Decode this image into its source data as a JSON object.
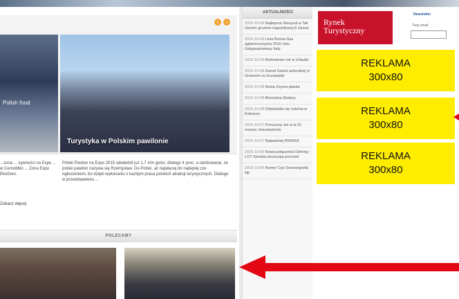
{
  "slider": {
    "left_caption": "Polish food",
    "main_caption": "Turystyka w Polskim pawilonie",
    "left_desc": "...zona ... zywności na Expo ... w Cernobbio ... Zona Expo EkoDom.",
    "right_desc": "Polski Pavilon na Expo 2015 odwiedził już 1,7 mln gości, dlatego 4 proc. a odzikowane, że polski pawilon nazywa się Rzemysław. Do Polski, aż najwięcej do najlepiej cze ogłoszeniem, bo dzięki wykonaniu z każdym prasa polskich atrakcji turystycznych. Dlatego w przedstawieniu ...",
    "more_link": "Zobacz więcej"
  },
  "polecamy": {
    "label": "POLECAMY"
  },
  "news": {
    "header": "AKTUALNOŚCI",
    "items": [
      {
        "date": "2015-10-09",
        "text": "Najlepsza Stosycal w Tak Gerzim gruzinie nagożdżanych Zaone"
      },
      {
        "date": "2015-10-09",
        "text": "Linia Brnina Gaz aglamrocenyma 2016 roku Galygazpowiazy Italy"
      },
      {
        "date": "2015-10-09",
        "text": "Rekordowe rok w Urlaubs"
      },
      {
        "date": "2015-10-08",
        "text": "Zavod Gańsk aslocalnej w Groenem zu Europejski"
      },
      {
        "date": "2015-10-08",
        "text": "Nowa Zeyma płaska"
      },
      {
        "date": "2015-10-08",
        "text": "Bricinalna Ekdany"
      },
      {
        "date": "2015-10-08",
        "text": "Odwiedziła się rodzina w Kotnarze"
      },
      {
        "date": "2015-10-07",
        "text": "Porozumy ani w ai 31 marzec mieszkańców"
      },
      {
        "date": "2015-10-07",
        "text": "Najważniej RINDKA"
      },
      {
        "date": "2015-10-06",
        "text": "Nowa połączenia Delhing - LOT Senoba anuncepp proceed"
      },
      {
        "date": "2015-10-06",
        "text": "Numer Cya Oceanografia kip"
      }
    ]
  },
  "logo": {
    "line1": "Rynek",
    "line2": "Turystyczny"
  },
  "newsletter": {
    "label": "Newsletter",
    "sub": "Twój email",
    "placeholder": ""
  },
  "ads": [
    {
      "line1": "REKLAMA",
      "line2": "300x80"
    },
    {
      "line1": "REKLAMA",
      "line2": "300x80"
    },
    {
      "line1": "REKLAMA",
      "line2": "300x80"
    }
  ],
  "colors": {
    "accent_orange": "#f2a432",
    "ad_yellow": "#ffed00",
    "arrow_red": "#e30613",
    "logo_red": "#c8122a"
  },
  "icons": {
    "prev": "chevron-left-icon",
    "next": "chevron-right-icon"
  }
}
